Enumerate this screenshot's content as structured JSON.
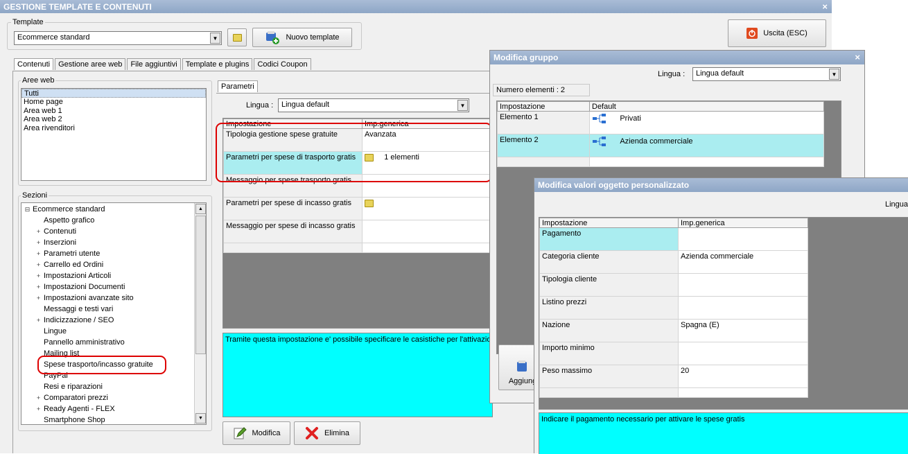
{
  "main": {
    "title": "GESTIONE TEMPLATE E CONTENUTI",
    "close": "×",
    "template_group_label": "Template",
    "template_value": "Ecommerce standard",
    "new_template_label": "Nuovo template",
    "exit_label": "Uscita (ESC)",
    "tabs": [
      "Contenuti",
      "Gestione aree web",
      "File aggiuntivi",
      "Template e plugins",
      "Codici Coupon"
    ],
    "aree_label": "Aree web",
    "aree": [
      "Tutti",
      "Home page",
      "Area web 1",
      "Area web 2",
      "Area rivenditori"
    ],
    "sezioni_label": "Sezioni",
    "sezioni": [
      {
        "label": "Ecommerce standard",
        "prefix": "⊟"
      },
      {
        "label": "Aspetto grafico",
        "prefix": ""
      },
      {
        "label": "Contenuti",
        "prefix": "+"
      },
      {
        "label": "Inserzioni",
        "prefix": "+"
      },
      {
        "label": "Parametri utente",
        "prefix": "+"
      },
      {
        "label": "Carrello ed Ordini",
        "prefix": "+"
      },
      {
        "label": "Impostazioni Articoli",
        "prefix": "+"
      },
      {
        "label": "Impostazioni Documenti",
        "prefix": "+"
      },
      {
        "label": "Impostazioni avanzate sito",
        "prefix": "+"
      },
      {
        "label": "Messaggi e testi vari",
        "prefix": ""
      },
      {
        "label": "Indicizzazione / SEO",
        "prefix": "+"
      },
      {
        "label": "Lingue",
        "prefix": ""
      },
      {
        "label": "Pannello amministrativo",
        "prefix": ""
      },
      {
        "label": "Mailing list",
        "prefix": ""
      },
      {
        "label": "Spese trasporto/incasso gratuite",
        "prefix": ""
      },
      {
        "label": "PayPal",
        "prefix": ""
      },
      {
        "label": "Resi e riparazioni",
        "prefix": ""
      },
      {
        "label": "Comparatori prezzi",
        "prefix": "+"
      },
      {
        "label": "Ready Agenti - FLEX",
        "prefix": "+"
      },
      {
        "label": "Smartphone Shop",
        "prefix": ""
      }
    ],
    "parametri_tab": "Parametri",
    "lingua_label": "Lingua :",
    "lingua_value": "Lingua default",
    "grid_headers": [
      "Impostazione",
      "Imp.generica"
    ],
    "grid_rows": [
      {
        "k": "Tipologia gestione spese gratuite",
        "v": "Avanzata"
      },
      {
        "k": "Parametri per spese di trasporto gratis",
        "v": "1 elementi"
      },
      {
        "k": "Messaggio per spese trasporto gratis",
        "v": ""
      },
      {
        "k": "Parametri per spese di incasso gratis",
        "v": ""
      },
      {
        "k": "Messaggio per spese di incasso gratis",
        "v": ""
      }
    ],
    "description": "Tramite questa impostazione e' possibile specificare le casistiche per l'attivazione",
    "modifica_label": "Modifica",
    "elimina_label": "Elimina"
  },
  "gruppo": {
    "title": "Modifica gruppo",
    "close": "×",
    "lingua_label": "Lingua :",
    "lingua_value": "Lingua default",
    "count_label": "Numero elementi : 2",
    "headers": [
      "Impostazione",
      "Default"
    ],
    "rows": [
      {
        "k": "Elemento 1",
        "v": "Privati"
      },
      {
        "k": "Elemento 2",
        "v": "Azienda commerciale"
      }
    ],
    "add_label": "Aggiung"
  },
  "oggetto": {
    "title": "Modifica valori oggetto personalizzato",
    "lingua_label": "Lingua",
    "headers": [
      "Impostazione",
      "Imp.generica"
    ],
    "rows": [
      {
        "k": "Pagamento",
        "v": ""
      },
      {
        "k": "Categoria cliente",
        "v": "Azienda commerciale"
      },
      {
        "k": "Tipologia cliente",
        "v": ""
      },
      {
        "k": "Listino prezzi",
        "v": ""
      },
      {
        "k": "Nazione",
        "v": "Spagna (E)"
      },
      {
        "k": "Importo minimo",
        "v": ""
      },
      {
        "k": "Peso massimo",
        "v": "20"
      }
    ],
    "description": "Indicare il pagamento necessario per attivare le spese gratis"
  },
  "colors": {
    "titlebar": "#9cb2d0",
    "highlight": "#aaedf0",
    "description": "#00ffff",
    "annotation": "#dd0000"
  }
}
